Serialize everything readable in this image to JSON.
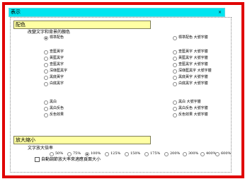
{
  "window": {
    "title": "表示",
    "close_glyph": "×"
  },
  "color_section": {
    "header": "配色",
    "subtitle": "改變文字和背景的顏色",
    "left_options": [
      "標準配色",
      "查藍黃字",
      "黃藍黑字",
      "查藍黑字",
      "深綠藍黑字",
      "黑底黃字",
      "白底黑字",
      "黑白",
      "黑白反色",
      "反色效果"
    ],
    "right_options": [
      "標準配色 大號字體",
      "查藍黃字 大號字體",
      "黃藍黑字 大號字體",
      "查藍黑字 大號字體",
      "深綠藍黑字 大號字體",
      "黑底黃字 大號字體",
      "白底黑字 大號字體",
      "黑白 大號字體",
      "黑白反色 大號字體",
      "反色效果 大號字體"
    ],
    "selected_index": 0
  },
  "zoom_section": {
    "header": "放大縮小",
    "subtitle": "文字放大倍率",
    "options": [
      "50%",
      "75%",
      "100%",
      "125%",
      "150%",
      "175%",
      "200%",
      "300%",
      "400%",
      "600%"
    ],
    "selected_index": 2,
    "checkbox_label": "自動調節放大率來適應頁面大小"
  }
}
